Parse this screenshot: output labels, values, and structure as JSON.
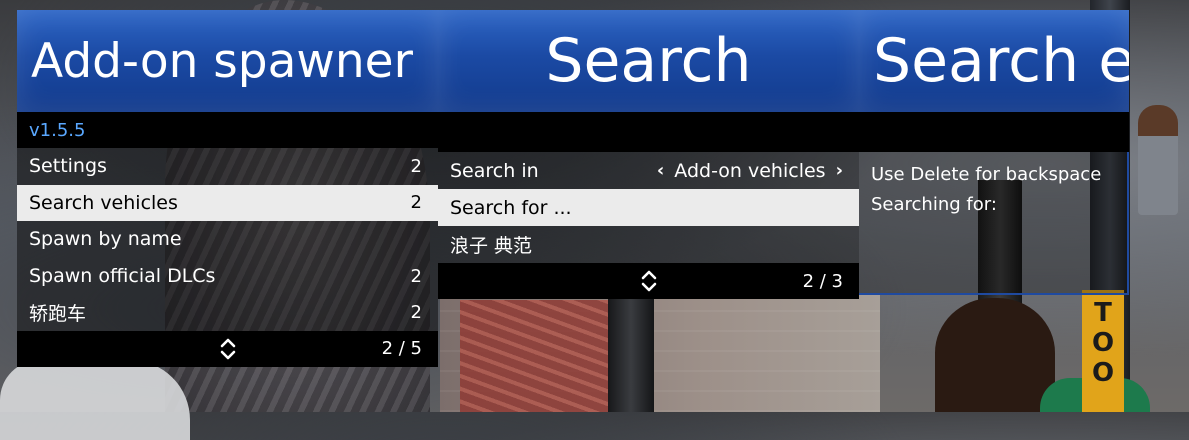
{
  "colors": {
    "header_blue": "#1b4aa4",
    "version_blue": "#5aa8ff",
    "selected_bg": "#ebebeb"
  },
  "menu_main": {
    "title": "Add-on spawner",
    "version": "v1.5.5",
    "items": [
      {
        "label": "Settings",
        "value": "2"
      },
      {
        "label": "Search vehicles",
        "value": "2",
        "selected": true
      },
      {
        "label": "Spawn by name",
        "value": ""
      },
      {
        "label": "Spawn official DLCs",
        "value": "2"
      },
      {
        "label": "轿跑车",
        "value": "2"
      }
    ],
    "footer_icon": "up-down-icon",
    "page": "2 / 5"
  },
  "menu_search": {
    "title": "Search",
    "items": [
      {
        "label": "Search in",
        "value": "Add-on vehicles"
      },
      {
        "label": "Search for ...",
        "selected": true
      },
      {
        "label": "浪子 典范"
      }
    ],
    "footer_icon": "up-down-icon",
    "page": "2 / 3"
  },
  "menu_search_entry": {
    "title": "Search e",
    "lines": [
      "Use Delete for backspace",
      "Searching for:"
    ]
  },
  "background": {
    "sign_text": "TOO"
  }
}
